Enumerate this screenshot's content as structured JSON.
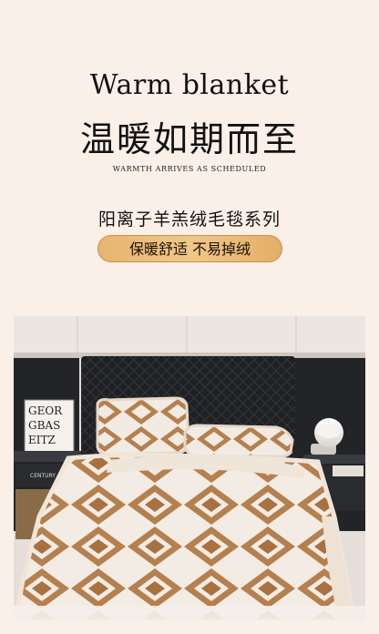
{
  "hero": {
    "title_en": "Warm blanket",
    "title_cn": "温暖如期而至",
    "subtitle_en": "WARMTH ARRIVES AS SCHEDULED"
  },
  "series": {
    "name": "阳离子羊羔绒毛毯系列"
  },
  "badge": {
    "text": "保暖舒适 不易掉绒"
  },
  "photo": {
    "frame_text": [
      "GEOR",
      "GBAS",
      "EITZ"
    ],
    "book_text": "CENTURY",
    "colors": {
      "wall": "#e4dcd7",
      "headboard": "#1e1f22",
      "blanket_base": "#f2ebe3",
      "pattern": "#b27a48",
      "pattern_dark": "#9a6436",
      "sherpa": "#efe5d8"
    }
  },
  "colors": {
    "background": "#fbf0e8",
    "pill_gold": "#e9b877"
  }
}
